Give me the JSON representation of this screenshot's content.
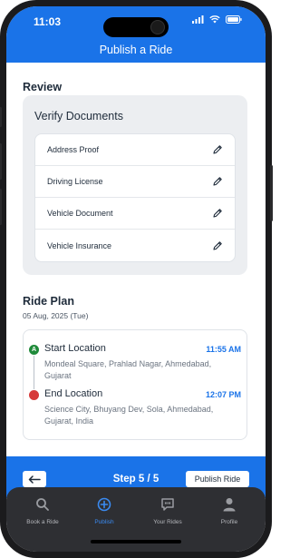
{
  "status_bar": {
    "time": "11:03"
  },
  "header": {
    "title": "Publish a Ride"
  },
  "review": {
    "section_title": "Review",
    "verify_title": "Verify Documents",
    "documents": [
      {
        "label": "Address Proof",
        "icon": "pencil-icon"
      },
      {
        "label": "Driving License",
        "icon": "pencil-icon"
      },
      {
        "label": "Vehicle Document",
        "icon": "pencil-icon"
      },
      {
        "label": "Vehicle Insurance",
        "icon": "pencil-icon"
      }
    ]
  },
  "ride_plan": {
    "section_title": "Ride Plan",
    "date": "05 Aug, 2025 (Tue)",
    "start": {
      "marker": "A",
      "title": "Start Location",
      "time": "11:55 AM",
      "address": "Mondeal Square, Prahlad Nagar, Ahmedabad, Gujarat"
    },
    "end": {
      "title": "End Location",
      "time": "12:07 PM",
      "address": "Science City, Bhuyang Dev, Sola, Ahmedabad, Gujarat, India"
    }
  },
  "stepper": {
    "step_text": "Step 5 / 5",
    "publish_label": "Publish Ride",
    "back_icon": "arrow-left-icon"
  },
  "tabbar": {
    "tabs": [
      {
        "label": "Book a Ride",
        "icon": "search-icon",
        "active": false
      },
      {
        "label": "Publish",
        "icon": "plus-circle-icon",
        "active": true
      },
      {
        "label": "Your Rides",
        "icon": "chat-quote-icon",
        "active": false
      },
      {
        "label": "Profile",
        "icon": "person-icon",
        "active": false
      }
    ]
  },
  "colors": {
    "primary": "#1a73e8",
    "start_marker": "#1f8a3a",
    "end_marker": "#d63a3a",
    "tabbar_bg": "#2e2f33"
  }
}
